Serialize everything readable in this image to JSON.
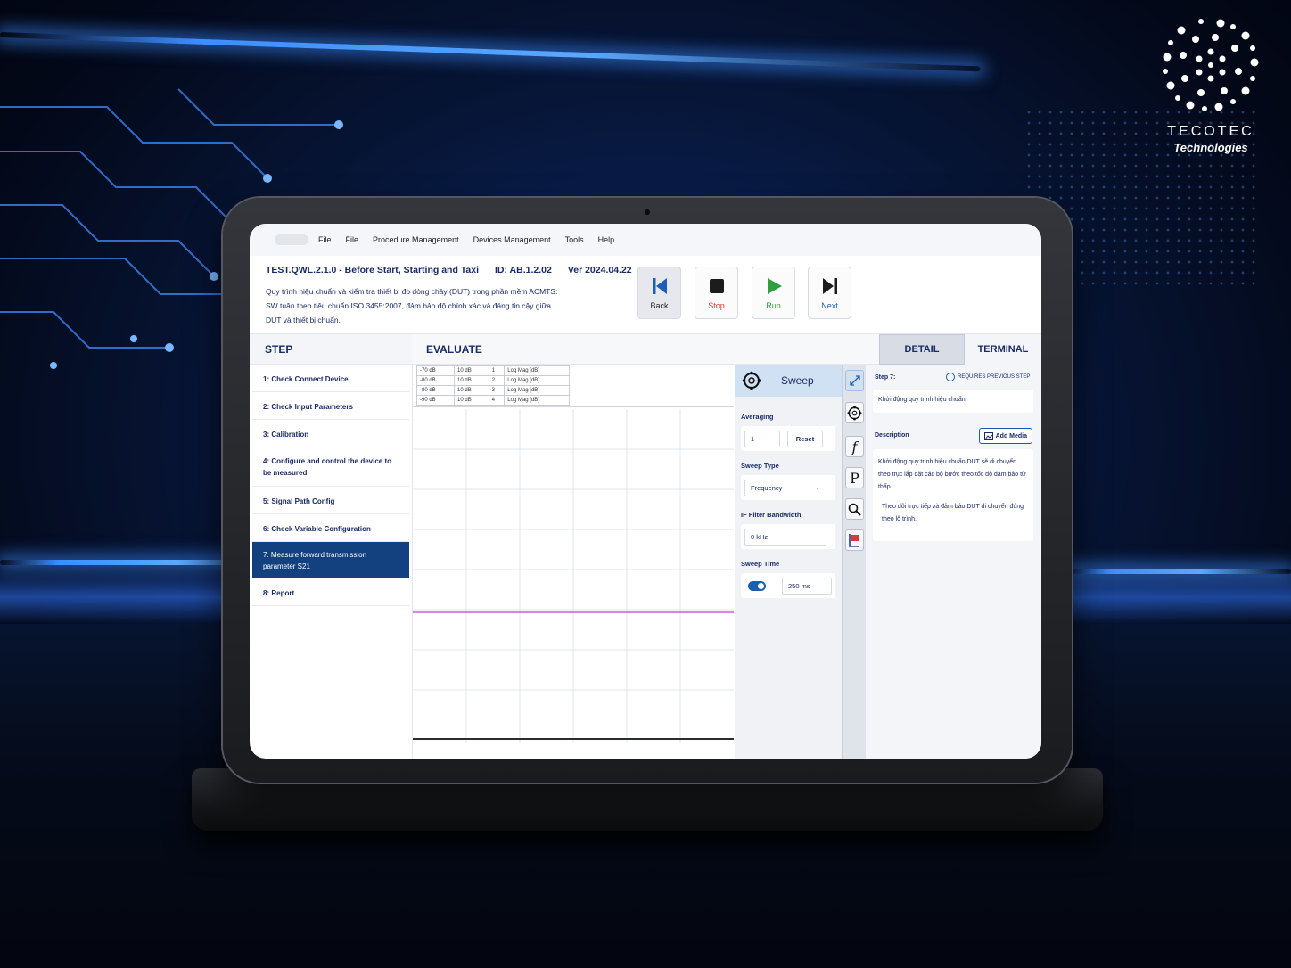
{
  "brand": {
    "name": "TECOTEC",
    "tagline": "Technologies"
  },
  "menu": [
    "File",
    "File",
    "Procedure Management",
    "Devices Management",
    "Tools",
    "Help"
  ],
  "procedure": {
    "code": "TEST.QWL.2.1.0 - Before Start, Starting and Taxi",
    "id": "ID: AB.1.2.02",
    "version": "Ver 2024.04.22",
    "description": "Quy trình hiệu chuẩn và kiểm tra thiết bị đo dòng chảy (DUT) trong phần mềm ACMTS: SW tuân theo tiêu chuẩn ISO 3455:2007, đảm bảo độ chính xác và đáng tin cậy giữa DUT và thiết bị chuẩn."
  },
  "controls": {
    "back": "Back",
    "stop": "Stop",
    "run": "Run",
    "next": "Next"
  },
  "colors": {
    "back": "#1b5fb3",
    "stop": "#e53935",
    "run": "#2e9e3e",
    "next": "#1b5fb3",
    "trace": "#c63bd6",
    "active_step": "#13417f"
  },
  "sections": {
    "step": "STEP",
    "evaluate": "EVALUATE",
    "detail": "DETAIL",
    "terminal": "TERMINAL"
  },
  "steps": [
    "1: Check Connect Device",
    "2: Check Input Parameters",
    "3: Calibration",
    "4: Configure and control the device to be measured",
    "5: Signal Path Config",
    "6: Check Variable Configuration",
    "7. Measure forward transmission parameter S21",
    "8: Report"
  ],
  "markers": [
    [
      "-70 dB",
      "10 dB",
      "1",
      "Log Mag [dB]"
    ],
    [
      "-80 dB",
      "10 dB",
      "2",
      "Log Mag [dB]"
    ],
    [
      "-80 dB",
      "10 dB",
      "3",
      "Log Mag [dB]"
    ],
    [
      "-90 dB",
      "10 dB",
      "4",
      "Log Mag [dB]"
    ]
  ],
  "sweep": {
    "title": "Sweep",
    "averaging_label": "Averaging",
    "averaging_value": "1",
    "reset_label": "Reset",
    "sweep_type_label": "Sweep Type",
    "sweep_type_value": "Frequency",
    "if_bw_label": "IF Filter Bandwidth",
    "if_bw_value": "0 kHz",
    "sweep_time_label": "Sweep Time",
    "sweep_time_value": "250 ms",
    "sweep_time_auto": true
  },
  "tools": [
    "settings-icon",
    "function-icon",
    "parameter-icon",
    "search-icon",
    "flag-icon"
  ],
  "tool_glyphs": {
    "f": "f",
    "p": "P"
  },
  "detail": {
    "step_label": "Step 7:",
    "requires_previous": "REQUIRES PREVIOUS STEP",
    "step_name": "Khởi động quy trình hiệu chuẩn",
    "description_label": "Description",
    "add_media": "Add Media",
    "desc_para1": "Khởi động quy trình hiệu chuẩn DUT sẽ di chuyển theo trục lắp đặt các bộ bước theo tốc độ đảm bảo từ thấp.",
    "desc_para2": "Theo dõi trực tiếp và đảm bảo DUT di chuyển đúng theo lộ trình."
  }
}
